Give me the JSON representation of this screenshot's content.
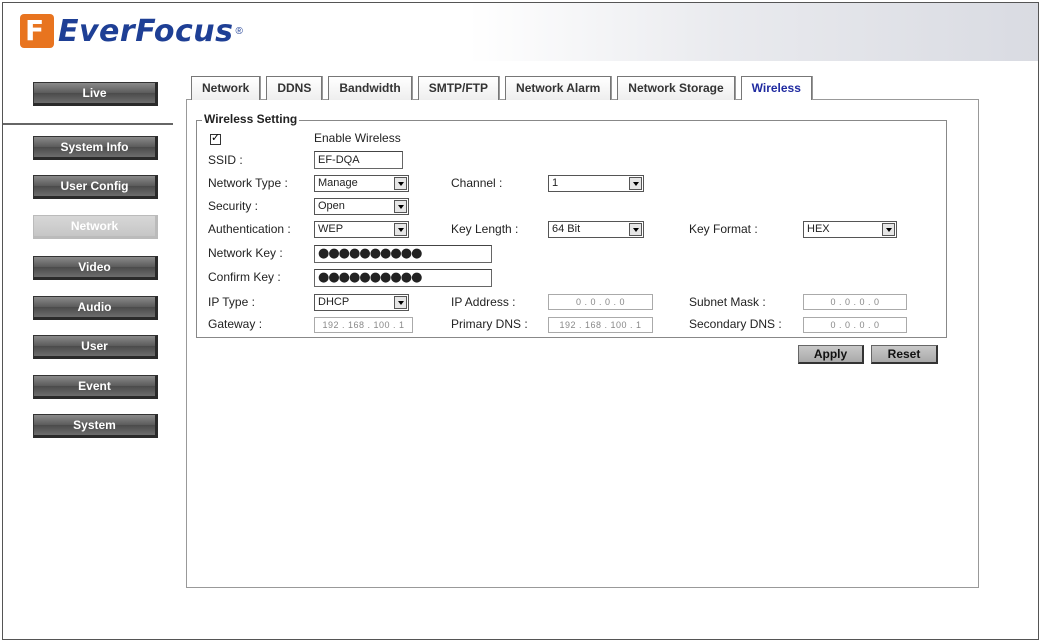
{
  "brand": {
    "name": "EverFocus",
    "mark": "F",
    "reg": "®"
  },
  "sidebar": {
    "items": [
      {
        "label": "Live"
      },
      {
        "label": "System Info"
      },
      {
        "label": "User Config"
      },
      {
        "label": "Network",
        "active": true
      },
      {
        "label": "Video"
      },
      {
        "label": "Audio"
      },
      {
        "label": "User"
      },
      {
        "label": "Event"
      },
      {
        "label": "System"
      }
    ]
  },
  "tabs": [
    {
      "label": "Network"
    },
    {
      "label": "DDNS"
    },
    {
      "label": "Bandwidth"
    },
    {
      "label": "SMTP/FTP"
    },
    {
      "label": "Network Alarm"
    },
    {
      "label": "Network Storage"
    },
    {
      "label": "Wireless",
      "active": true
    }
  ],
  "wireless": {
    "legend": "Wireless Setting",
    "enable_label": "Enable Wireless",
    "enable_checked": true,
    "check_mark": "✓",
    "ssid_label": "SSID :",
    "ssid_value": "EF-DQA",
    "network_type_label": "Network Type :",
    "network_type_value": "Manage",
    "channel_label": "Channel :",
    "channel_value": "1",
    "security_label": "Security :",
    "security_value": "Open",
    "authentication_label": "Authentication :",
    "authentication_value": "WEP",
    "key_length_label": "Key Length :",
    "key_length_value": "64 Bit",
    "key_format_label": "Key Format :",
    "key_format_value": "HEX",
    "network_key_label": "Network Key :",
    "network_key_value": "●●●●●●●●●●",
    "confirm_key_label": "Confirm Key :",
    "confirm_key_value": "●●●●●●●●●●",
    "ip_type_label": "IP Type :",
    "ip_type_value": "DHCP",
    "ip_address_label": "IP Address :",
    "ip_address_value": "0 . 0 . 0 . 0",
    "subnet_mask_label": "Subnet Mask :",
    "subnet_mask_value": "0 . 0 . 0 . 0",
    "gateway_label": "Gateway :",
    "gateway_value": "192 . 168 . 100 . 1",
    "primary_dns_label": "Primary DNS :",
    "primary_dns_value": "192 . 168 . 100 . 1",
    "secondary_dns_label": "Secondary DNS :",
    "secondary_dns_value": "0 . 0 . 0 . 0"
  },
  "actions": {
    "apply_label": "Apply",
    "reset_label": "Reset"
  },
  "colors": {
    "brand_orange": "#e8741f",
    "brand_blue": "#1e3f95",
    "active_tab": "#1f2aa0"
  }
}
